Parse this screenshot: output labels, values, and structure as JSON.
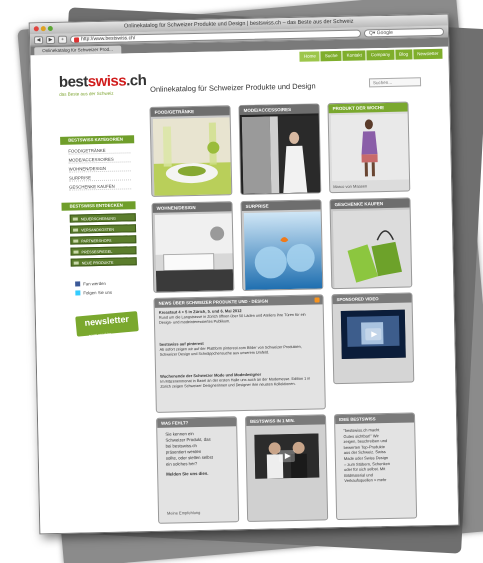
{
  "browser": {
    "window_title": "Onlinekatalog für Schweizer Produkte und Design | bestswiss.ch – das Beste aus der Schweiz",
    "url": "http://www.bestswiss.ch/",
    "search_placeholder": "Q▾ Google",
    "tab_label": "Onlinekatalog für Schweizer Prod...",
    "nav_back": "◀",
    "nav_forward": "▶",
    "add": "+"
  },
  "topnav": [
    "Home",
    "Suche",
    "Kontakt",
    "Company",
    "Blog",
    "Newsletter"
  ],
  "logo": {
    "part1": "best",
    "part2": "swiss",
    "part3": ".ch",
    "tagline": "das Beste aus der Schweiz"
  },
  "headline": "Onlinekatalog für Schweizer Produkte und Design",
  "search_placeholder": "Suchen...",
  "sidebar": {
    "categories_title": "BESTSWISS KATEGORIEN",
    "categories": [
      "FOOD/GETRÄNKE",
      "MODE/ACCESSOIRES",
      "WOHNEN/DESIGN",
      "SURPRISE",
      "GESCHENKE KAUFEN"
    ],
    "discover_title": "BESTSWISS ENTDECKEN",
    "discover": [
      "NEUERSCHEINUNG",
      "VERSANDKOSTEN",
      "PARTNERSHOPS",
      "PRESSESPIEGEL",
      "NEUE PRODUKTE"
    ],
    "social": [
      "Fan werden",
      "Folgen Sie uns"
    ],
    "newsletter": "newsletter",
    "newsletter_small": "● jetzt anmelden"
  },
  "tiles": [
    {
      "title": "FOOD/GETRÄNKE"
    },
    {
      "title": "MODE/ACCESSOIRES"
    },
    {
      "title": "PRODUKT DER WOCHE",
      "caption": "Marco von Maasen"
    },
    {
      "title": "WOHNEN/DESIGN"
    },
    {
      "title": "SURPRISE"
    },
    {
      "title": "GESCHENKE KAUFEN"
    }
  ],
  "news": {
    "title": "NEWS ÜBER SCHWEIZER PRODUKTE UND - DESIGN",
    "items": [
      {
        "head": "Kreastaut 4 + 5 in Zürich, 5. und 6. Mai 2012",
        "body": "Rund um die Langstrasse in Zürich öffnen über 50 Läden und Ateliers ihre Türen für ein Design- und modeinteressiertes Publikum."
      },
      {
        "head": "bestswiss auf pinterest",
        "body": "Ab sofort zeigen wir auf der Plattform pinterest.com Bilder von Schweizer Produkten, Schweizer Design und Schnäppchensuche aus unserem Umfeld."
      },
      {
        "head": "Wochenende der Schweizer Mode und Modedesigner",
        "body": "Im Mäzenenmonat in Basel an der ersten Halle uns auch an der Modemesse. Edition 1 in Zürich zeigen Schweizer Designerinnen und Designer ihre neusten Kollektionen."
      }
    ]
  },
  "video_box": {
    "title": "SPONSORED VIDEO"
  },
  "was_fehlt": {
    "title": "WAS FEHLT?",
    "lines": [
      "Sie kennen ein",
      "Schweizer Produkt, das",
      "bei bestswiss.ch",
      "präsentiert werden",
      "sollte, oder stellen selbst",
      "ein solches her?"
    ],
    "cta": "Melden Sie uns dies.",
    "link": "Meine Empfehlung"
  },
  "minute_box": {
    "title": "BESTSWISS IN 1 MIN."
  },
  "idee_box": {
    "title": "IDEE BESTSWISS",
    "lines": [
      "\"bestswiss.ch macht",
      "Gutes sichtbar!\" Wir",
      "zeigen, beschreiben und",
      "bewerten Top-Produkte",
      "aus der Schweiz. Swiss",
      "Made oder Swiss Design",
      "– zum Stöbern, Schenken",
      "oder für sich selbst. Mit",
      "Bildmaterial und",
      "Verkaufsquellen > mehr"
    ]
  }
}
